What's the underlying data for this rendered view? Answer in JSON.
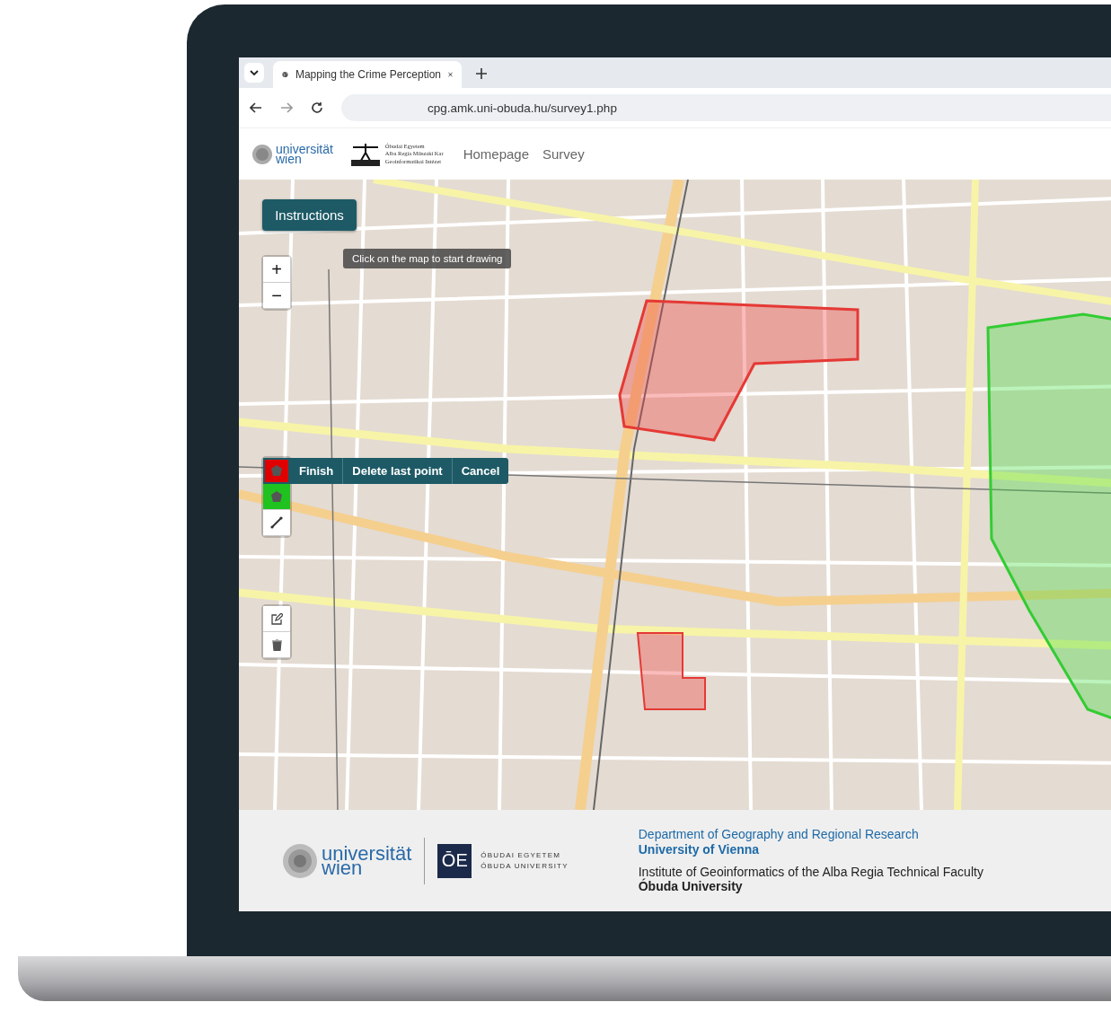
{
  "browser": {
    "tab_title": "Mapping the Crime Perception",
    "url": "cpg.amk.uni-obuda.hu/survey1.php"
  },
  "header": {
    "logo_vienna": [
      "universität",
      "wien"
    ],
    "logo_obuda": [
      "Óbudai Egyetem",
      "Alba Regia Műszaki Kar",
      "Geoinformatikai Intézet"
    ],
    "nav": [
      {
        "label": "Homepage"
      },
      {
        "label": "Survey"
      }
    ]
  },
  "map": {
    "instructions_button": "Instructions",
    "hint": "Click on the map to start drawing",
    "zoom_in": "+",
    "zoom_out": "−",
    "draw_tools": [
      {
        "kind": "polygon",
        "color": "#e00000",
        "selected": true
      },
      {
        "kind": "polygon",
        "color": "#1fc21f",
        "selected": false
      },
      {
        "kind": "line",
        "color": "#ffffff",
        "selected": false
      }
    ],
    "draw_actions": [
      "Finish",
      "Delete last point",
      "Cancel"
    ]
  },
  "footer": {
    "logo_vienna": [
      "universität",
      "wien"
    ],
    "logo_obuda_mark": "ŌE",
    "logo_obuda": [
      "ÓBUDAI EGYETEM",
      "ÓBUDA UNIVERSITY"
    ],
    "credits": [
      {
        "department": "Department of Geography and Regional Research",
        "university": "University of Vienna",
        "kind": "blue"
      },
      {
        "department": "Institute of Geoinformatics of the Alba Regia Technical Faculty",
        "university": "Óbuda University",
        "kind": "dark"
      }
    ]
  }
}
